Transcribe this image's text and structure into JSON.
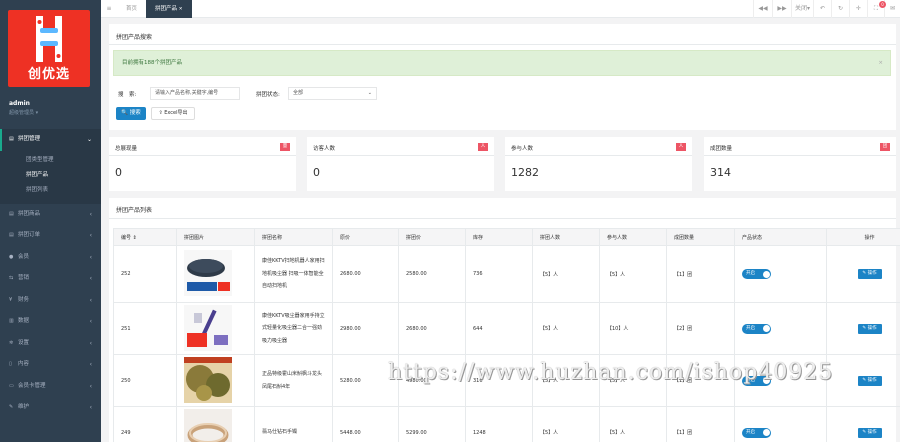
{
  "brand": {
    "logo_text": "创优选",
    "logo_bg": "#ee3124"
  },
  "user": {
    "name": "admin",
    "role": "超级管理员 ▾"
  },
  "menu": [
    {
      "label": "拼团管理",
      "icon": "list-icon",
      "expanded": true,
      "children": [
        "团类型管理",
        "拼团产品",
        "拼团列表"
      ],
      "current": "拼团产品"
    },
    {
      "label": "拼团商品",
      "icon": "list-icon"
    },
    {
      "label": "拼团订单",
      "icon": "list-icon"
    },
    {
      "label": "会员",
      "icon": "user-icon"
    },
    {
      "label": "营销",
      "icon": "share-icon"
    },
    {
      "label": "财务",
      "icon": "money-icon"
    },
    {
      "label": "数据",
      "icon": "chart-icon"
    },
    {
      "label": "设置",
      "icon": "gear-icon"
    },
    {
      "label": "内容",
      "icon": "file-icon"
    },
    {
      "label": "会员卡管理",
      "icon": "card-icon"
    },
    {
      "label": "维护",
      "icon": "wrench-icon"
    }
  ],
  "topbar": {
    "menu_icon": "≡",
    "tabs": [
      {
        "label": "首页"
      },
      {
        "label": "拼团产品",
        "close": "✕"
      }
    ],
    "right_buttons": [
      "◀◀",
      "▶▶",
      "关闭▾",
      "↶",
      "↻",
      "✛",
      "⛶",
      "✉",
      "⤢"
    ],
    "badge": "0"
  },
  "search": {
    "title": "拼团产品搜索",
    "alert": "目前拥有188个拼团产品",
    "alert_close": "×",
    "keyword_label": "搜　索:",
    "keyword_placeholder": "请输入产品名称,关键字,编号",
    "status_label": "拼团状态:",
    "status_value": "全部",
    "search_button": "🔍 搜索",
    "excel_button": "⇪ Excel导出"
  },
  "stats": [
    {
      "title": "总展现量",
      "badge": "量",
      "value": "0"
    },
    {
      "title": "访客人数",
      "badge": "人",
      "value": "0"
    },
    {
      "title": "参与人数",
      "badge": "人",
      "value": "1282"
    },
    {
      "title": "成团数量",
      "badge": "团",
      "value": "314"
    }
  ],
  "table": {
    "title": "拼团产品列表",
    "headers": [
      "编号 ⇕",
      "拼团图片",
      "拼团名称",
      "原价",
      "拼团价",
      "库存",
      "拼团人数",
      "参与人数",
      "成团数量",
      "产品状态",
      "操作"
    ],
    "rows": [
      {
        "id": "252",
        "name": "康佳KKTV扫地机器人家用扫地机吸尘器 扫吸一体智能全自动扫地机",
        "price": "2680.00",
        "group_price": "2580.00",
        "stock": "736",
        "group_size": "【5】人",
        "joined": "【5】人",
        "done": "【1】团",
        "status": "开启",
        "op": "✎ 操作"
      },
      {
        "id": "251",
        "name": "康佳KKTV吸尘器家用手持立式轻量化吸尘器二合一强劲吸力吸尘器",
        "price": "2980.00",
        "group_price": "2680.00",
        "stock": "644",
        "group_size": "【5】人",
        "joined": "【10】人",
        "done": "【2】团",
        "status": "开启",
        "op": "✎ 操作"
      },
      {
        "id": "250",
        "name": "正品特级霍山米斛枫斗龙头凤尾石斛4年",
        "price": "5280.00",
        "group_price": "4980.00",
        "stock": "316",
        "group_size": "【5】人",
        "joined": "【5】人",
        "done": "【1】团",
        "status": "开启",
        "op": "✎ 操作"
      },
      {
        "id": "249",
        "name": "翡马仕钻石手镯",
        "price": "5448.00",
        "group_price": "5299.00",
        "stock": "1248",
        "group_size": "【5】人",
        "joined": "【5】人",
        "done": "【1】团",
        "status": "开启",
        "op": "✎ 操作"
      }
    ]
  },
  "watermark": "https://www.huzhan.com/ishop40925",
  "colors": {
    "sidebar": "#2f4050",
    "primary": "#1c84c6",
    "warning": "#f8ac59",
    "danger": "#ed5565"
  }
}
